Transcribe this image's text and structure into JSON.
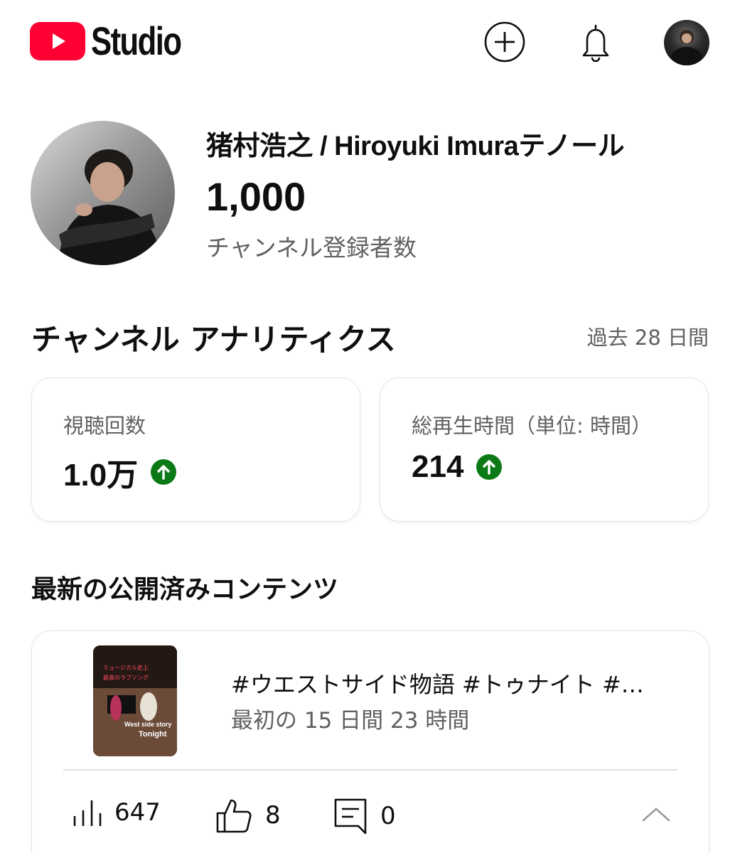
{
  "header": {
    "app_name": "Studio",
    "icons": [
      "create-icon",
      "notifications-icon",
      "account-avatar"
    ]
  },
  "channel": {
    "name": "猪村浩之 / Hiroyuki Imuraテノール",
    "subscriber_count": "1,000",
    "subscriber_label": "チャンネル登録者数"
  },
  "analytics": {
    "title": "チャンネル アナリティクス",
    "period": "過去 28 日間",
    "cards": [
      {
        "label": "視聴回数",
        "value": "1.0万",
        "trend": "up"
      },
      {
        "label": "総再生時間（単位: 時間）",
        "value": "214",
        "trend": "up"
      }
    ]
  },
  "latest": {
    "title": "最新の公開済みコンテンツ",
    "video": {
      "title": "#ウエストサイド物語 #トゥナイト #…",
      "time": "最初の 15 日間 23 時間",
      "thumb_text_top": "ミュージカル史上",
      "thumb_text_mid": "最高のラブソング",
      "thumb_text_en1": "West side story",
      "thumb_text_en2": "Tonight",
      "views": "647",
      "likes": "8",
      "comments": "0"
    }
  },
  "colors": {
    "brand_red": "#ff0033",
    "trend_green": "#0b7a16",
    "muted_text": "#606060"
  }
}
